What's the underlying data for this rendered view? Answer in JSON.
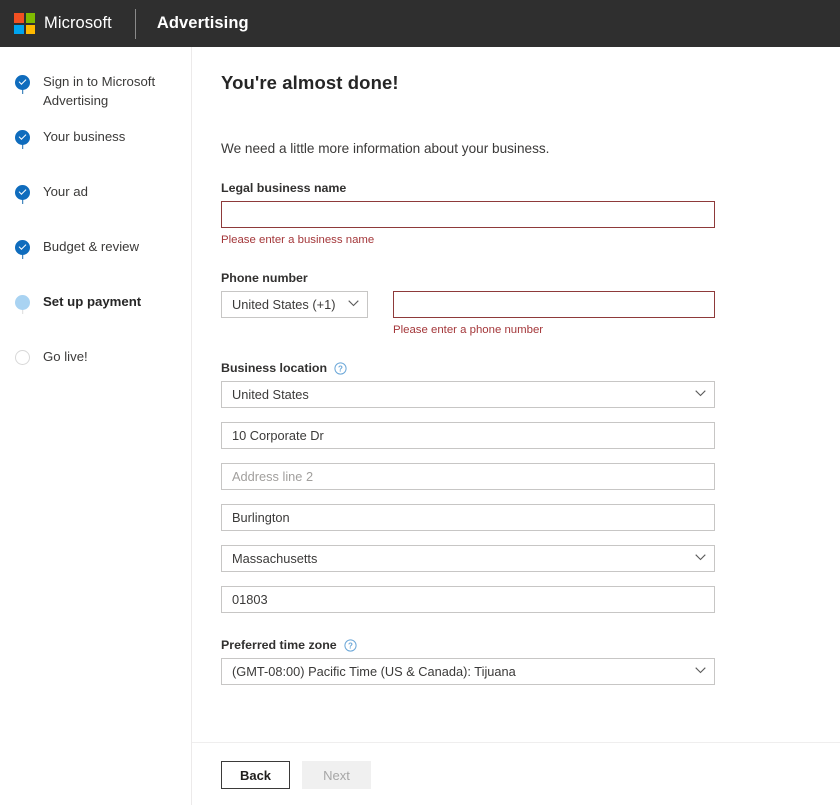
{
  "header": {
    "logo_icon": "microsoft-logo-icon",
    "microsoft_word": "Microsoft",
    "brand": "Advertising"
  },
  "sidebar": {
    "steps": [
      {
        "label": "Sign in to Microsoft Advertising",
        "state": "done"
      },
      {
        "label": "Your business",
        "state": "done"
      },
      {
        "label": "Your ad",
        "state": "done"
      },
      {
        "label": "Budget & review",
        "state": "done"
      },
      {
        "label": "Set up payment",
        "state": "current"
      },
      {
        "label": "Go live!",
        "state": "todo"
      }
    ]
  },
  "main": {
    "title": "You're almost done!",
    "intro": "We need a little more information about your business.",
    "legal_business_name": {
      "label": "Legal business name",
      "value": "",
      "placeholder": "",
      "error": "Please enter a business name"
    },
    "phone_number": {
      "label": "Phone number",
      "country_code_value": "United States (+1)",
      "value": "",
      "placeholder": "",
      "error": "Please enter a phone number"
    },
    "business_location": {
      "label": "Business location",
      "help_icon": "help-circle-icon",
      "country": "United States",
      "address_line_1": "10 Corporate Dr",
      "address_line_2": "",
      "address_line_2_placeholder": "Address line 2",
      "city": "Burlington",
      "state": "Massachusetts",
      "postal_code": "01803"
    },
    "preferred_time_zone": {
      "label": "Preferred time zone",
      "help_icon": "help-circle-icon",
      "value": "(GMT-08:00) Pacific Time (US & Canada): Tijuana"
    }
  },
  "footer": {
    "back_label": "Back",
    "next_label": "Next"
  },
  "colors": {
    "header_bg": "#2f2f2f",
    "step_done": "#0f6cbd",
    "step_current": "#a9d3f2",
    "error_text": "#a4373a",
    "error_border": "#8e3a3a"
  }
}
